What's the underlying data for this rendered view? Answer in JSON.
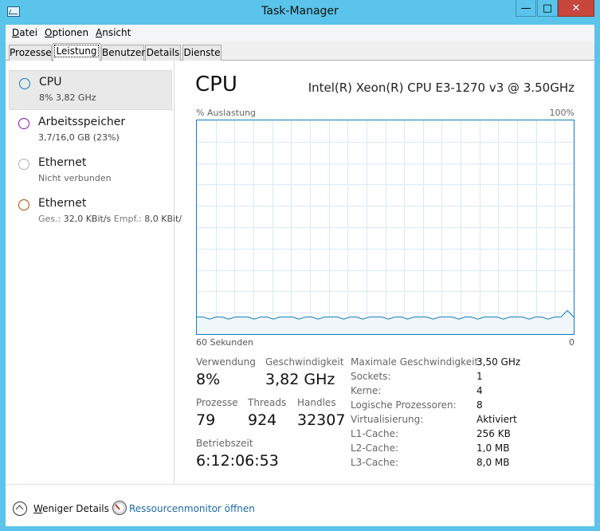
{
  "window": {
    "title": "Task-Manager"
  },
  "menu": [
    "Datei",
    "Optionen",
    "Ansicht"
  ],
  "tabs": [
    "Prozesse",
    "Leistung",
    "Benutzer",
    "Details",
    "Dienste"
  ],
  "active_tab": "Leistung",
  "sidebar": [
    {
      "label": "CPU",
      "sub": "8% 3,82 GHz",
      "color": "#117dbb",
      "selected": true
    },
    {
      "label": "Arbeitsspeicher",
      "sub": "3,7/16,0 GB (23%)",
      "color": "#8b12ae"
    },
    {
      "label": "Ethernet",
      "sub": "Nicht verbunden",
      "color": "#a0a0a0"
    },
    {
      "label": "Ethernet",
      "sub_prefix1": "Ges.:",
      "sub_value1": "32,0 KBit/s",
      "sub_prefix2": "Empf.:",
      "sub_value2": "8,0 KBit/",
      "color": "#a74f01"
    }
  ],
  "main": {
    "title": "CPU",
    "model": "Intel(R) Xeon(R) CPU E3-1270 v3 @ 3.50GHz",
    "graph_ylabel": "% Auslastung",
    "graph_ymax": "100%",
    "graph_xlabel": "60 Sekunden",
    "graph_xmin": "0",
    "stats": {
      "verwendung_label": "Verwendung",
      "verwendung": "8%",
      "geschwindigkeit_label": "Geschwindigkeit",
      "geschwindigkeit": "3,82 GHz",
      "prozesse_label": "Prozesse",
      "prozesse": "79",
      "threads_label": "Threads",
      "threads": "924",
      "handles_label": "Handles",
      "handles": "32307",
      "betriebszeit_label": "Betriebszeit",
      "betriebszeit": "6:12:06:53"
    },
    "specs": [
      {
        "label": "Maximale Geschwindigkeit:",
        "value": "3,50 GHz"
      },
      {
        "label": "Sockets:",
        "value": "1"
      },
      {
        "label": "Kerne:",
        "value": "4"
      },
      {
        "label": "Logische Prozessoren:",
        "value": "8"
      },
      {
        "label": "Virtualisierung:",
        "value": "Aktiviert"
      },
      {
        "label": "L1-Cache:",
        "value": "256 KB"
      },
      {
        "label": "L2-Cache:",
        "value": "1,0 MB"
      },
      {
        "label": "L3-Cache:",
        "value": "8,0 MB"
      }
    ]
  },
  "footer": {
    "less_details": "Weniger Details",
    "resource_monitor": "Ressourcenmonitor öffnen"
  },
  "chart_data": {
    "type": "area",
    "ylim": [
      0,
      100
    ],
    "xlim": [
      60,
      0
    ],
    "values": [
      8,
      8,
      7,
      8,
      8,
      7,
      8,
      8,
      8,
      7,
      8,
      8,
      7,
      8,
      8,
      8,
      7,
      8,
      8,
      7,
      8,
      8,
      8,
      7,
      8,
      8,
      7,
      8,
      8,
      8,
      7,
      8,
      8,
      7,
      8,
      8,
      8,
      7,
      8,
      8,
      8,
      7,
      8,
      8,
      7,
      8,
      8,
      8,
      7,
      8,
      8,
      8,
      7,
      8,
      8,
      7,
      8,
      8,
      11,
      8
    ]
  }
}
